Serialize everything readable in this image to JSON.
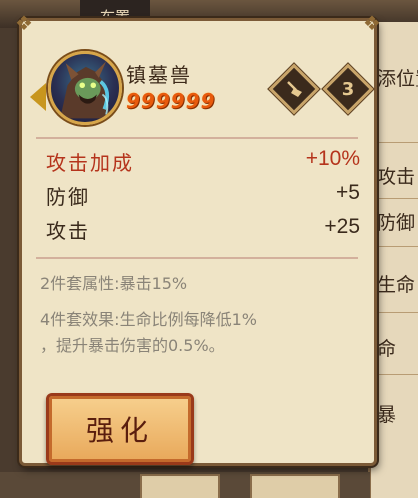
{
  "background": {
    "top_tab": "布置",
    "right_labels": [
      "添位置",
      "攻击",
      "防御",
      "生命",
      "命",
      "暴"
    ]
  },
  "card": {
    "name": "镇墓兽",
    "score": "999999",
    "badge_left_icon": "broom-icon",
    "badge_right_icon": "number-three-icon",
    "badge_right_glyph": "3",
    "stats": [
      {
        "label": "攻击加成",
        "value": "+10%",
        "highlight": true
      },
      {
        "label": "防御",
        "value": "+5",
        "highlight": false
      },
      {
        "label": "攻击",
        "value": "+25",
        "highlight": false
      }
    ],
    "set_bonus_2": "2件套属性:暴击15%",
    "set_bonus_4_line1": "4件套效果:生命比例每降低1%",
    "set_bonus_4_line2": "，提升暴击伤害的0.5%。",
    "upgrade_button": "强化"
  },
  "colors": {
    "card_bg": "#efe4c6",
    "highlight_stat": "#b5341c",
    "score": "#e85a0c",
    "button": "#e8a85a"
  }
}
